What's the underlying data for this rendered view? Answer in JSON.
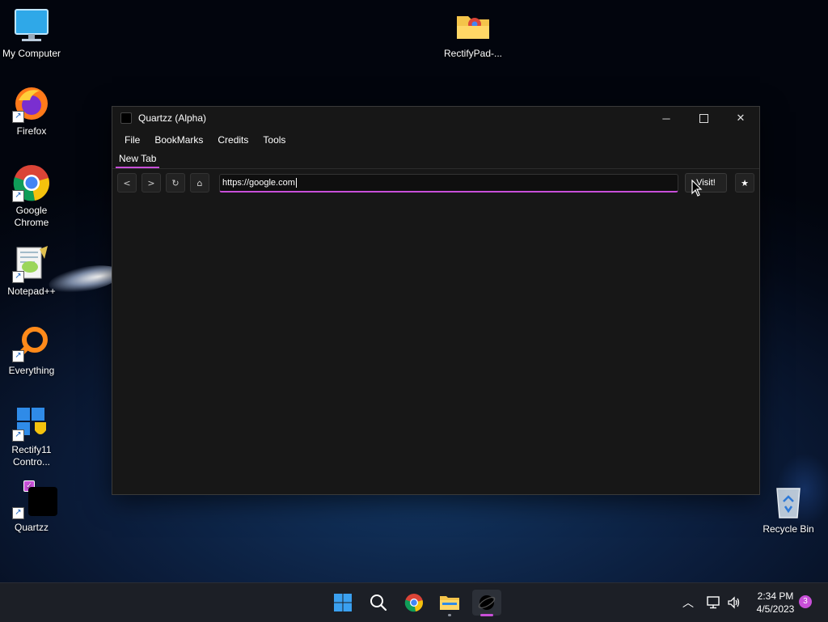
{
  "desktop": {
    "icons": [
      {
        "label": "My Computer"
      },
      {
        "label": "Firefox"
      },
      {
        "label": "Google Chrome"
      },
      {
        "label": "Notepad++"
      },
      {
        "label": "Everything"
      },
      {
        "label": "Rectify11 Contro..."
      },
      {
        "label": "Quartzz"
      },
      {
        "label": "RectifyPad-..."
      },
      {
        "label": "Recycle Bin"
      }
    ]
  },
  "window": {
    "title": "Quartzz (Alpha)",
    "menu": [
      "File",
      "BookMarks",
      "Credits",
      "Tools"
    ],
    "tab": "New Tab",
    "nav": {
      "back": "<",
      "forward": ">",
      "reload": "↻",
      "home": "⌂",
      "url": "https://google.com",
      "visit": "Visit!",
      "bookmark": "★"
    }
  },
  "taskbar": {
    "time": "2:34 PM",
    "date": "4/5/2023",
    "notifications": "3"
  },
  "colors": {
    "accent": "#c84fd8",
    "window_bg": "#171717"
  }
}
